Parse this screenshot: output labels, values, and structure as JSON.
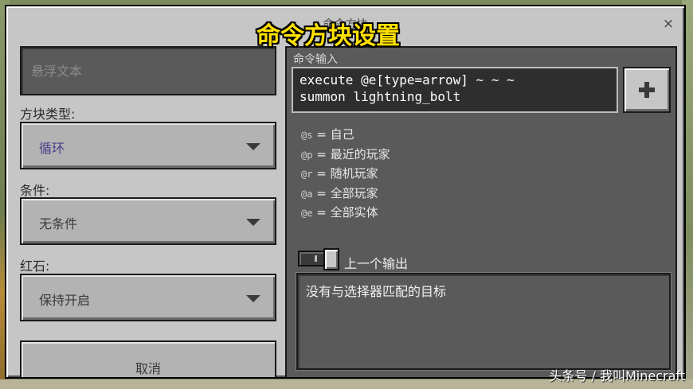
{
  "window": {
    "title": "命令方块",
    "close_glyph": "×"
  },
  "caption": "命令方块设置",
  "left": {
    "hover_text_placeholder": "悬浮文本",
    "block_type_label": "方块类型:",
    "block_type_value": "循环",
    "condition_label": "条件:",
    "condition_value": "无条件",
    "redstone_label": "红石:",
    "redstone_value": "保持开启",
    "cancel_label": "取消"
  },
  "right": {
    "command_input_label": "命令输入",
    "command_text": "execute @e[type=arrow] ~ ~ ~\nsummon lightning_bolt",
    "add_button_glyph": "+",
    "selectors": [
      {
        "code": "@s",
        "desc": "自己"
      },
      {
        "code": "@p",
        "desc": "最近的玩家"
      },
      {
        "code": "@r",
        "desc": "随机玩家"
      },
      {
        "code": "@a",
        "desc": "全部玩家"
      },
      {
        "code": "@e",
        "desc": "全部实体"
      }
    ],
    "previous_output_label": "上一个输出",
    "previous_output_on": true,
    "output_text": "没有与选择器匹配的目标"
  },
  "watermark": "头条号 / 我叫Minecraft"
}
